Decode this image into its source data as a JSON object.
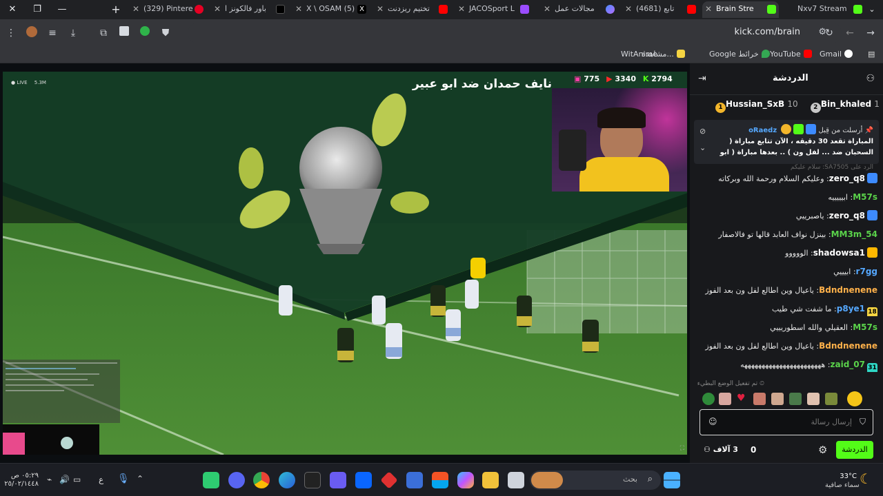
{
  "tabs": [
    {
      "title": "Nxv7 Stream",
      "color": "#53fc18"
    },
    {
      "title": "Brain Stre",
      "color": "#53fc18",
      "active": true
    },
    {
      "title": "(4681) تابع",
      "color": "#ff0000"
    },
    {
      "title": "مجالات عمل",
      "color": "#4a8cff"
    },
    {
      "title": "JACOSport L",
      "color": "#9a4cff"
    },
    {
      "title": "تختيم ريزدنت",
      "color": "#ff0000"
    },
    {
      "title": "X \\ OSAM (5)",
      "color": "#ffffff"
    },
    {
      "title": "باور فالكونز ا",
      "color": "#000000"
    },
    {
      "title": "(329) Pintere",
      "color": "#e60023"
    }
  ],
  "toolbar": {
    "url": "kick.com/brain"
  },
  "bookmarks": [
    "Gmail",
    "YouTube",
    "Google خرائط",
    "مشاهدة...",
    "WitAnime"
  ],
  "video": {
    "title_overlay": "نايف حمدان ضد ابو عبير",
    "stats": {
      "viewers": "775",
      "youtube": "3340",
      "kick": "2794"
    },
    "live_label": "LIVE",
    "viewer_small": "5.3M"
  },
  "chat": {
    "header_title": "الدردشة",
    "top_gifters": [
      {
        "rank": "1",
        "name": "Hussian_SxB",
        "count": "10"
      },
      {
        "rank": "2",
        "name": "Bin_khaled",
        "count": "1"
      }
    ],
    "pinned": {
      "label": "أرسلت من قِبل",
      "user": "oRaedz",
      "text": "المباراة تقعد 30 دقيقه ، الآن تتابع مباراة ( السحبان ضد ... لفل ون ) .. بعدها مباراة ( ابو عبير ضد نايف حمدان )"
    },
    "reply_hint": "الرد على SA7505: سلام عليكم",
    "messages": [
      {
        "user": "zero_q8",
        "text": "وعليكم السلام ورحمة الله وبركاته",
        "style": "u",
        "badge": "#3d8bff"
      },
      {
        "user": "M57s",
        "text": "ابيييييه",
        "style": "ug",
        "badge": ""
      },
      {
        "user": "zero_q8",
        "text": "ياصبرييي",
        "style": "u",
        "badge": "#3d8bff"
      },
      {
        "user": "MM3m_54",
        "text": "بينزل نواف العابد قالها تو فالاصفار",
        "style": "ug",
        "badge": ""
      },
      {
        "user": "shadowsa1",
        "text": "الووووو",
        "style": "u",
        "badge": "#ffb800"
      },
      {
        "user": "r7gg",
        "text": "ابيييي",
        "style": "ug",
        "badge": ""
      },
      {
        "user": "Bdndnenene",
        "text": "ياعيال وين اطالع لفل ون بعد الفوز",
        "style": "uo",
        "badge": ""
      },
      {
        "user": "p8ye1",
        "text": "ما شفت شي طيب",
        "style": "ug",
        "badge": "#f5d442"
      },
      {
        "user": "M57s",
        "text": "العقيلي والله اسطوريييي",
        "style": "ug",
        "badge": ""
      },
      {
        "user": "Bdndnenene",
        "text": "ياعيال وين اطالع لفل ون بعد الفوز",
        "style": "uo",
        "badge": ""
      },
      {
        "user": "zaid_07",
        "text": "هههههههههههههههههههههههه",
        "style": "ug",
        "badge": "#2fd6c4"
      }
    ],
    "p8ye1_badge": "18",
    "zaid_badge": "31",
    "slow_mode": "تم تفعيل الوضع البطيء",
    "input_placeholder": "إرسال رسالة",
    "send_button": "الدردشة",
    "viewers_count": "3 آلاف",
    "points": "0"
  },
  "taskbar": {
    "weather_temp": "33°C",
    "weather_desc": "سماء صافية",
    "search_placeholder": "بحث",
    "time": "٠٥:٢٩ ص",
    "date": "٢٥/٠٢/١٤٤٨",
    "lang": "ع"
  }
}
